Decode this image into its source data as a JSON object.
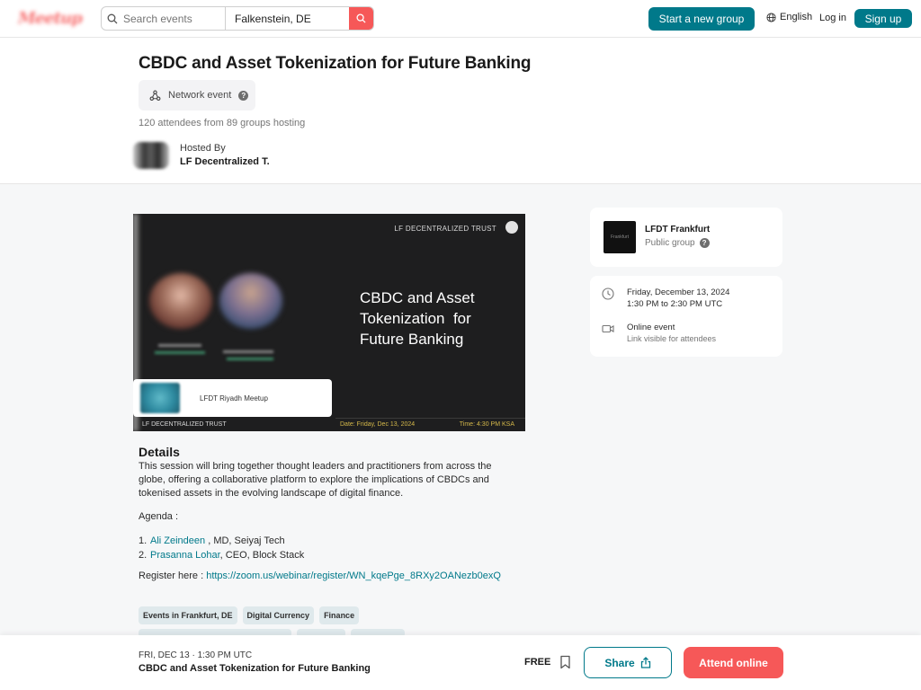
{
  "header": {
    "logo_text": "Meetup",
    "search_placeholder": "Search events",
    "location_value": "Falkenstein, DE",
    "start_group_label": "Start a new group",
    "language_label": "English",
    "login_label": "Log in",
    "signup_label": "Sign up"
  },
  "event": {
    "title": "CBDC and Asset Tokenization for Future Banking",
    "network_badge": "Network event",
    "attendees_text": "120 attendees from 89 groups hosting",
    "hosted_by_label": "Hosted By",
    "host_name": "LF Decentralized T."
  },
  "banner": {
    "brand_top": "LF DECENTRALIZED TRUST",
    "headline_line1": "CBDC and Asset",
    "headline_line2": "Tokenization  for",
    "headline_line3": "Future Banking",
    "meetup_label": "LFDT Riyadh Meetup",
    "brand_bottom": "LF DECENTRALIZED TRUST",
    "date_text": "Date: Friday, Dec 13, 2024",
    "time_text": "Time: 4:30 PM KSA"
  },
  "details": {
    "heading": "Details",
    "paragraph": "This session will bring together thought leaders and practitioners from across the globe, offering a collaborative platform to explore the implications of CBDCs and tokenised assets in the evolving landscape of digital finance.",
    "agenda_label": "Agenda :",
    "agenda_items": [
      {
        "num": "1.",
        "name": "Ali Zeindeen",
        "rest": " , MD, Seiyaj Tech"
      },
      {
        "num": "2.",
        "name": "Prasanna Lohar",
        "rest": ", CEO, Block Stack"
      }
    ],
    "register_label": "Register here : ",
    "register_link": "https://zoom.us/webinar/register/WN_kqePge_8RXy2OANezb0exQ"
  },
  "tags": [
    "Events in Frankfurt, DE",
    "Digital Currency",
    "Finance"
  ],
  "group_card": {
    "name": "LFDT Frankfurt",
    "type": "Public group",
    "thumb_text": "Frankfurt"
  },
  "info_card": {
    "date_line1": "Friday, December 13, 2024",
    "date_line2": "1:30 PM to 2:30 PM UTC",
    "online_line1": "Online event",
    "online_line2": "Link visible for attendees"
  },
  "bottom_bar": {
    "date": "FRI, DEC 13 · 1:30 PM UTC",
    "title": "CBDC and Asset Tokenization for Future Banking",
    "price": "FREE",
    "share_label": "Share",
    "attend_label": "Attend online"
  },
  "colors": {
    "brand_red": "#f65858",
    "brand_teal": "#00798a",
    "page_gray": "#f6f7f8"
  }
}
